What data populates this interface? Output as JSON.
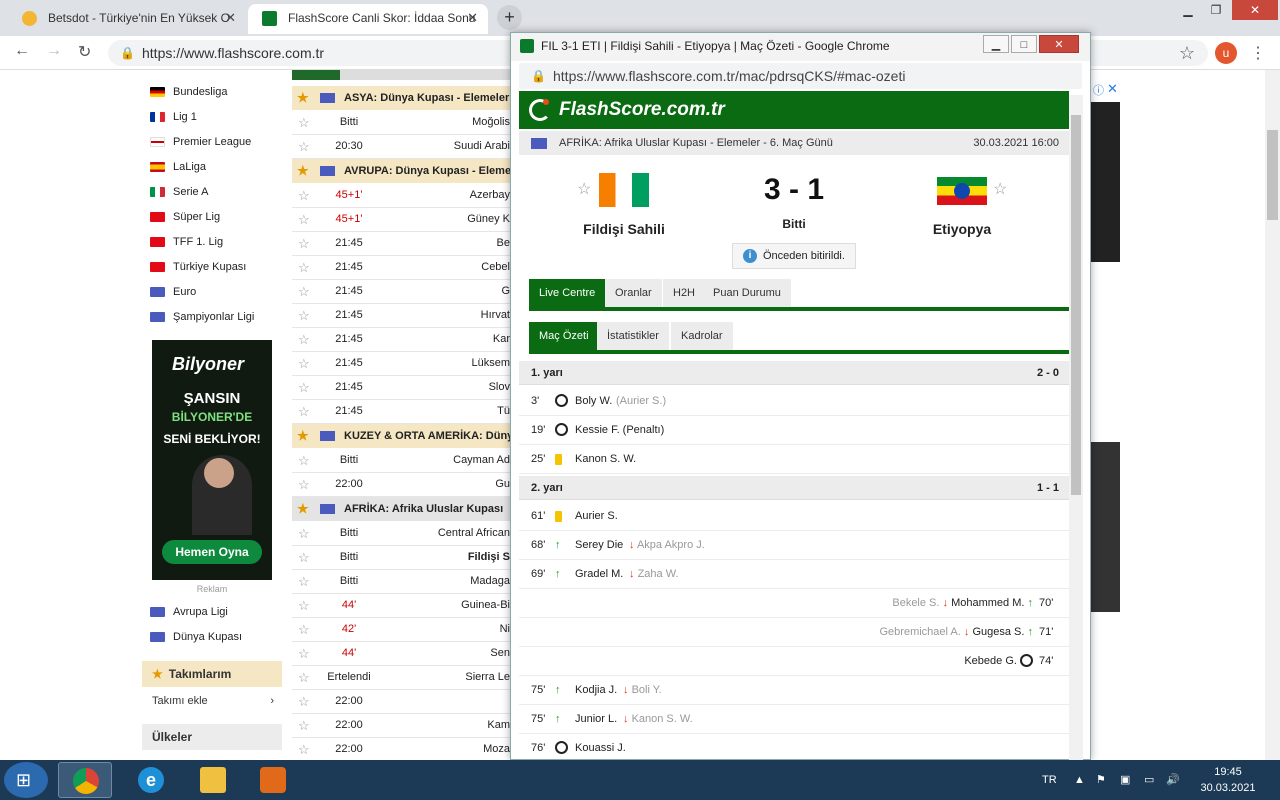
{
  "browser": {
    "tabs": [
      {
        "label": "Betsdot - Türkiye'nin En Yüksek O"
      },
      {
        "label": "FlashScore Canli Skor: İddaa Sonu"
      }
    ],
    "url": "https://www.flashscore.com.tr",
    "avatar_letter": "u"
  },
  "sidebar": {
    "leagues": [
      {
        "name": "Bundesliga",
        "flag": "flag-germany-icon"
      },
      {
        "name": "Lig 1",
        "flag": "flag-france-icon"
      },
      {
        "name": "Premier League",
        "flag": "flag-england-icon"
      },
      {
        "name": "LaLiga",
        "flag": "flag-spain-icon"
      },
      {
        "name": "Serie A",
        "flag": "flag-italy-icon"
      },
      {
        "name": "Süper Lig",
        "flag": "flag-turkey-icon"
      },
      {
        "name": "TFF 1. Lig",
        "flag": "flag-turkey-icon"
      },
      {
        "name": "Türkiye Kupası",
        "flag": "flag-turkey-icon"
      },
      {
        "name": "Euro",
        "flag": "flag-europe-icon"
      },
      {
        "name": "Şampiyonlar Ligi",
        "flag": "flag-europe-icon"
      }
    ],
    "ad": {
      "brand": "Bilyoner",
      "line1": "ŞANSIN",
      "line2": "BİLYONER'DE",
      "line3": "SENİ BEKLİYOR!",
      "cta": "Hemen Oyna",
      "label": "Reklam"
    },
    "leagues2": [
      {
        "name": "Avrupa Ligi"
      },
      {
        "name": "Dünya Kupası"
      }
    ],
    "teams_header": "Takımlarım",
    "add_team": "Takımı ekle",
    "countries_header": "Ülkeler"
  },
  "feed": {
    "groups": [
      {
        "title": "ASYA: Dünya Kupası - Elemeler"
      },
      {
        "title": "AVRUPA: Dünya Kupası - Elemeler"
      },
      {
        "title": "KUZEY & ORTA AMERİKA: Dünya"
      },
      {
        "title": "AFRİKA: Afrika Uluslar Kupası"
      }
    ],
    "rows": [
      {
        "time": "Bitti",
        "team": "Moğolis",
        "live": false
      },
      {
        "time": "20:30",
        "team": "Suudi Arabi",
        "live": false
      },
      {
        "time": "45+1'",
        "team": "Azerbay",
        "live": true
      },
      {
        "time": "45+1'",
        "team": "Güney K",
        "live": true
      },
      {
        "time": "21:45",
        "team": "Be",
        "live": false
      },
      {
        "time": "21:45",
        "team": "Cebel",
        "live": false
      },
      {
        "time": "21:45",
        "team": "G",
        "live": false
      },
      {
        "time": "21:45",
        "team": "Hırvat",
        "live": false
      },
      {
        "time": "21:45",
        "team": "Kar",
        "live": false
      },
      {
        "time": "21:45",
        "team": "Lüksem",
        "live": false
      },
      {
        "time": "21:45",
        "team": "Slov",
        "live": false
      },
      {
        "time": "21:45",
        "team": "Tü",
        "live": false
      },
      {
        "time": "Bitti",
        "team": "Cayman Ad",
        "live": false
      },
      {
        "time": "22:00",
        "team": "Gu",
        "live": false
      },
      {
        "time": "Bitti",
        "team": "Central African",
        "live": false
      },
      {
        "time": "Bitti",
        "team": "Fildişi S",
        "live": false,
        "bold": true
      },
      {
        "time": "Bitti",
        "team": "Madaga",
        "live": false
      },
      {
        "time": "44'",
        "team": "Guinea-Bi",
        "live": true
      },
      {
        "time": "42'",
        "team": "Ni",
        "live": true
      },
      {
        "time": "44'",
        "team": "Sen",
        "live": true
      },
      {
        "time": "Ertelendi",
        "team": "Sierra Le",
        "live": false
      },
      {
        "time": "22:00",
        "team": "",
        "live": false
      },
      {
        "time": "22:00",
        "team": "Kam",
        "live": false
      },
      {
        "time": "22:00",
        "team": "Moza",
        "live": false
      }
    ]
  },
  "popup": {
    "title": "FIL 3-1 ETI | Fildişi Sahili - Etiyopya | Maç Özeti - Google Chrome",
    "url": "https://www.flashscore.com.tr/mac/pdrsqCKS/#mac-ozeti",
    "brand": "FlashScore.com.tr",
    "competition": "AFRİKA: Afrika Uluslar Kupası - Elemeler - 6. Maç Günü",
    "date": "30.03.2021 16:00",
    "home": "Fildişi Sahili",
    "away": "Etiyopya",
    "score": "3 - 1",
    "status": "Bitti",
    "note": "Önceden bitirildi.",
    "tabs": [
      "Live Centre",
      "Oranlar",
      "H2H",
      "Puan Durumu"
    ],
    "subtabs": [
      "Maç Özeti",
      "İstatistikler",
      "Kadrolar"
    ],
    "halves": [
      {
        "name": "1. yarı",
        "score": "2 - 0"
      },
      {
        "name": "2. yarı",
        "score": "1 - 1"
      }
    ],
    "events": [
      {
        "min": "3'",
        "type": "goal",
        "side": "home",
        "p1": "Boly W.",
        "p2": "(Aurier S.)"
      },
      {
        "min": "19'",
        "type": "goal",
        "side": "home",
        "p1": "Kessie F. (Penaltı)",
        "p2": ""
      },
      {
        "min": "25'",
        "type": "card",
        "side": "home",
        "p1": "Kanon S. W.",
        "p2": ""
      },
      {
        "min": "61'",
        "type": "card",
        "side": "home",
        "p1": "Aurier S.",
        "p2": ""
      },
      {
        "min": "68'",
        "type": "sub",
        "side": "home",
        "p1": "Serey Die",
        "p2": "Akpa Akpro J."
      },
      {
        "min": "69'",
        "type": "sub",
        "side": "home",
        "p1": "Gradel M.",
        "p2": "Zaha W."
      },
      {
        "min": "70'",
        "type": "sub",
        "side": "away",
        "p1": "Mohammed M.",
        "p2": "Bekele S."
      },
      {
        "min": "71'",
        "type": "sub",
        "side": "away",
        "p1": "Gugesa S.",
        "p2": "Gebremichael A."
      },
      {
        "min": "74'",
        "type": "goal",
        "side": "away",
        "p1": "Kebede G.",
        "p2": ""
      },
      {
        "min": "75'",
        "type": "sub",
        "side": "home",
        "p1": "Kodjia J.",
        "p2": "Boli Y."
      },
      {
        "min": "75'",
        "type": "sub",
        "side": "home",
        "p1": "Junior L.",
        "p2": "Kanon S. W."
      },
      {
        "min": "76'",
        "type": "goal",
        "side": "home",
        "p1": "Kouassi J.",
        "p2": ""
      }
    ]
  },
  "taskbar": {
    "lang": "TR",
    "time": "19:45",
    "date": "30.03.2021"
  },
  "colors": {
    "flashscore_green": "#0a6b12",
    "live_red": "#cc0000",
    "group_header": "#f5e7c4"
  }
}
